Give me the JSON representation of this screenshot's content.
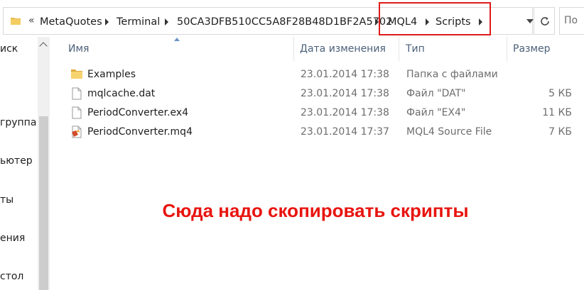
{
  "address_bar": {
    "overflow": "«",
    "crumbs": [
      "MetaQuotes",
      "Terminal",
      "50CA3DFB510CC5A8F28B48D1BF2A5702",
      "MQL4",
      "Scripts"
    ],
    "search_placeholder": "По"
  },
  "nav_pane": {
    "items": [
      "иск",
      "группа",
      "ьютер",
      "ты",
      "ения",
      "стол"
    ]
  },
  "columns": {
    "name": "Имя",
    "date": "Дата изменения",
    "type": "Тип",
    "size": "Размер"
  },
  "files": [
    {
      "name": "Examples",
      "date": "23.01.2014 17:38",
      "type": "Папка с файлами",
      "size": "",
      "icon": "folder-icon"
    },
    {
      "name": "mqlcache.dat",
      "date": "23.01.2014 17:38",
      "type": "Файл \"DAT\"",
      "size": "5 КБ",
      "icon": "file-icon"
    },
    {
      "name": "PeriodConverter.ex4",
      "date": "23.01.2014 17:38",
      "type": "Файл \"EX4\"",
      "size": "11 КБ",
      "icon": "file-icon"
    },
    {
      "name": "PeriodConverter.mq4",
      "date": "23.01.2014 17:37",
      "type": "MQL4 Source File",
      "size": "7 КБ",
      "icon": "mq4-file-icon"
    }
  ],
  "annotation": "Сюда надо скопировать скрипты",
  "colors": {
    "highlight": "#e01a1a",
    "annotation": "#e8140f",
    "header_text": "#4c607a"
  }
}
